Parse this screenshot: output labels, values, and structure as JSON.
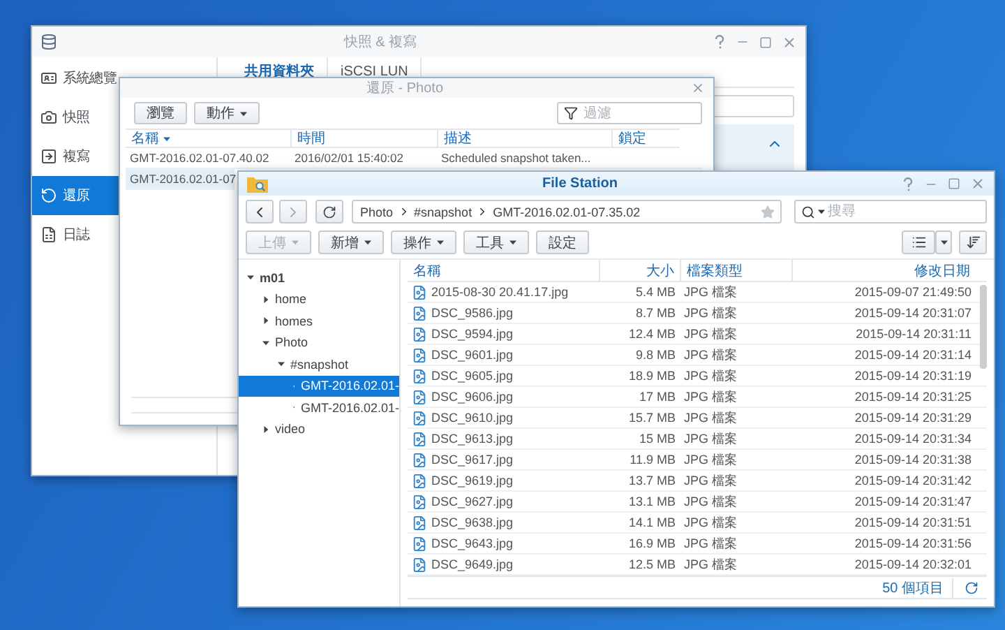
{
  "snapshot_window": {
    "title": "快照 & 複寫",
    "sidebar": [
      {
        "label": "系統總覽",
        "selected": false
      },
      {
        "label": "快照",
        "selected": false
      },
      {
        "label": "複寫",
        "selected": false
      },
      {
        "label": "還原",
        "selected": true
      },
      {
        "label": "日誌",
        "selected": false
      }
    ],
    "tabs": [
      {
        "label": "共用資料夾",
        "selected": true
      },
      {
        "label": "iSCSI LUN",
        "selected": false
      }
    ]
  },
  "restore_dialog": {
    "title": "還原 - Photo",
    "buttons": [
      {
        "label": "瀏覽",
        "dropdown": false
      },
      {
        "label": "動作",
        "dropdown": true
      }
    ],
    "filter": {
      "placeholder": "過濾"
    },
    "columns": [
      {
        "label": "名稱",
        "sorted": true
      },
      {
        "label": "時間",
        "sorted": false
      },
      {
        "label": "描述",
        "sorted": false
      },
      {
        "label": "鎖定",
        "sorted": false
      }
    ],
    "rows": [
      {
        "cells": [
          "GMT-2016.02.01-07.40.02",
          "2016/02/01 15:40:02",
          "Scheduled snapshot taken..."
        ],
        "selected": false
      },
      {
        "cells": [
          "GMT-2016.02.01-07"
        ],
        "selected": true
      }
    ]
  },
  "file_station": {
    "title": "File Station",
    "path": [
      "Photo",
      "#snapshot",
      "GMT-2016.02.01-07.35.02"
    ],
    "search": {
      "placeholder": "搜尋"
    },
    "toolbar": [
      {
        "label": "上傳",
        "dropdown": true,
        "disabled": true
      },
      {
        "label": "新增",
        "dropdown": true,
        "disabled": false
      },
      {
        "label": "操作",
        "dropdown": true,
        "disabled": false
      },
      {
        "label": "工具",
        "dropdown": true,
        "disabled": false
      },
      {
        "label": "設定",
        "dropdown": false,
        "disabled": false
      }
    ],
    "tree": [
      {
        "label": "m01",
        "expanded": true,
        "selected": false,
        "children": [
          {
            "label": "home",
            "expanded": false,
            "selected": false
          },
          {
            "label": "homes",
            "expanded": false,
            "selected": false
          },
          {
            "label": "Photo",
            "expanded": true,
            "selected": false,
            "children": [
              {
                "label": "#snapshot",
                "expanded": true,
                "selected": false,
                "children": [
                  {
                    "label": "GMT-2016.02.01-",
                    "expanded": false,
                    "selected": true
                  },
                  {
                    "label": "GMT-2016.02.01-",
                    "expanded": false,
                    "selected": false
                  }
                ]
              }
            ]
          },
          {
            "label": "video",
            "expanded": false,
            "selected": false
          }
        ]
      }
    ],
    "columns": [
      "名稱",
      "大小",
      "檔案類型",
      "修改日期"
    ],
    "files": [
      {
        "name": "2015-08-30 20.41.17.jpg",
        "size": "5.4 MB",
        "type": "JPG 檔案",
        "modified": "2015-09-07 21:49:50"
      },
      {
        "name": "DSC_9586.jpg",
        "size": "8.7 MB",
        "type": "JPG 檔案",
        "modified": "2015-09-14 20:31:07"
      },
      {
        "name": "DSC_9594.jpg",
        "size": "12.4 MB",
        "type": "JPG 檔案",
        "modified": "2015-09-14 20:31:11"
      },
      {
        "name": "DSC_9601.jpg",
        "size": "9.8 MB",
        "type": "JPG 檔案",
        "modified": "2015-09-14 20:31:14"
      },
      {
        "name": "DSC_9605.jpg",
        "size": "18.9 MB",
        "type": "JPG 檔案",
        "modified": "2015-09-14 20:31:19"
      },
      {
        "name": "DSC_9606.jpg",
        "size": "17 MB",
        "type": "JPG 檔案",
        "modified": "2015-09-14 20:31:25"
      },
      {
        "name": "DSC_9610.jpg",
        "size": "15.7 MB",
        "type": "JPG 檔案",
        "modified": "2015-09-14 20:31:29"
      },
      {
        "name": "DSC_9613.jpg",
        "size": "15 MB",
        "type": "JPG 檔案",
        "modified": "2015-09-14 20:31:34"
      },
      {
        "name": "DSC_9617.jpg",
        "size": "11.9 MB",
        "type": "JPG 檔案",
        "modified": "2015-09-14 20:31:38"
      },
      {
        "name": "DSC_9619.jpg",
        "size": "13.7 MB",
        "type": "JPG 檔案",
        "modified": "2015-09-14 20:31:42"
      },
      {
        "name": "DSC_9627.jpg",
        "size": "13.1 MB",
        "type": "JPG 檔案",
        "modified": "2015-09-14 20:31:47"
      },
      {
        "name": "DSC_9638.jpg",
        "size": "14.1 MB",
        "type": "JPG 檔案",
        "modified": "2015-09-14 20:31:51"
      },
      {
        "name": "DSC_9643.jpg",
        "size": "16.9 MB",
        "type": "JPG 檔案",
        "modified": "2015-09-14 20:31:56"
      },
      {
        "name": "DSC_9649.jpg",
        "size": "12.5 MB",
        "type": "JPG 檔案",
        "modified": "2015-09-14 20:32:01"
      }
    ],
    "item_count": "50 個項目"
  }
}
